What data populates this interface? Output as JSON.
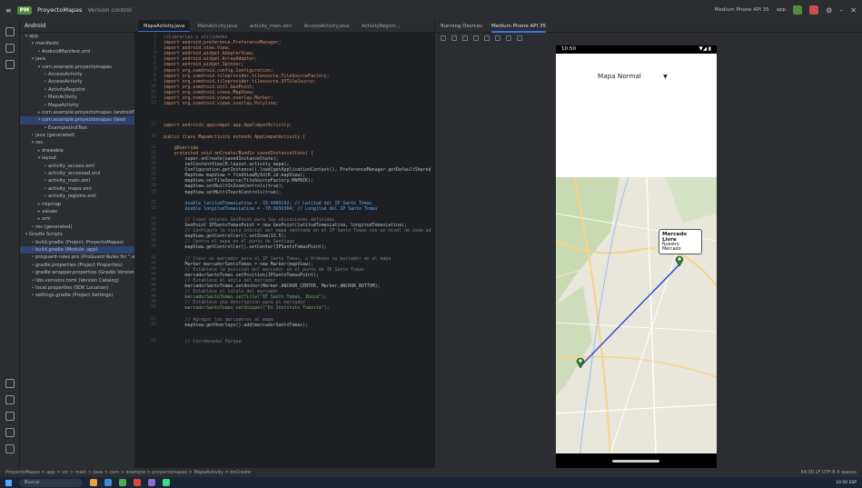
{
  "topbar": {
    "project_badge": "PM",
    "project_name": "ProyectoMapas",
    "version_control": "Version control",
    "device_selector": "Medium Phone API 35",
    "run_config": "app"
  },
  "project_panel": {
    "header": "Android",
    "rows": [
      {
        "label": "app",
        "indent": 0,
        "glyph": "▾"
      },
      {
        "label": "manifests",
        "indent": 1,
        "glyph": "▾"
      },
      {
        "label": "AndroidManifest.xml",
        "indent": 2,
        "glyph": ""
      },
      {
        "label": "java",
        "indent": 1,
        "glyph": "▾"
      },
      {
        "label": "com.example.proyectomapas",
        "indent": 2,
        "glyph": "▾"
      },
      {
        "label": "AccesoActivity",
        "indent": 3,
        "glyph": ""
      },
      {
        "label": "AccesoActivity",
        "indent": 3,
        "glyph": ""
      },
      {
        "label": "ActivityRegistro",
        "indent": 3,
        "glyph": ""
      },
      {
        "label": "MainActivity",
        "indent": 3,
        "glyph": ""
      },
      {
        "label": "MapaActivity",
        "indent": 3,
        "glyph": ""
      },
      {
        "label": "com.example.proyectomapas (androidTest)",
        "indent": 2,
        "glyph": "▸"
      },
      {
        "label": "com.example.proyectomapas (test)",
        "indent": 2,
        "glyph": "▾",
        "selected": true
      },
      {
        "label": "ExampleUnitTest",
        "indent": 3,
        "glyph": ""
      },
      {
        "label": "java (generated)",
        "indent": 1,
        "glyph": ""
      },
      {
        "label": "res",
        "indent": 1,
        "glyph": "▾"
      },
      {
        "label": "drawable",
        "indent": 2,
        "glyph": "▸"
      },
      {
        "label": "layout",
        "indent": 2,
        "glyph": "▾"
      },
      {
        "label": "activity_acceso.xml",
        "indent": 3,
        "glyph": ""
      },
      {
        "label": "activity_accesoad.xml",
        "indent": 3,
        "glyph": ""
      },
      {
        "label": "activity_main.xml",
        "indent": 3,
        "glyph": ""
      },
      {
        "label": "activity_mapa.xml",
        "indent": 3,
        "glyph": ""
      },
      {
        "label": "activity_registro.xml",
        "indent": 3,
        "glyph": ""
      },
      {
        "label": "mipmap",
        "indent": 2,
        "glyph": "▸"
      },
      {
        "label": "values",
        "indent": 2,
        "glyph": "▸"
      },
      {
        "label": "xml",
        "indent": 2,
        "glyph": "▸"
      },
      {
        "label": "res (generated)",
        "indent": 1,
        "glyph": ""
      },
      {
        "label": "Gradle Scripts",
        "indent": 0,
        "glyph": "▾"
      },
      {
        "label": "build.gradle (Project: ProyectoMapas)",
        "indent": 1,
        "glyph": ""
      },
      {
        "label": "build.gradle (Module :app)",
        "indent": 1,
        "glyph": "",
        "selected": true
      },
      {
        "label": "proguard-rules.pro (ProGuard Rules for \":app\")",
        "indent": 1,
        "glyph": ""
      },
      {
        "label": "gradle.properties (Project Properties)",
        "indent": 1,
        "glyph": ""
      },
      {
        "label": "gradle-wrapper.properties (Gradle Version)",
        "indent": 1,
        "glyph": ""
      },
      {
        "label": "libs.versions.toml (Version Catalog)",
        "indent": 1,
        "glyph": ""
      },
      {
        "label": "local.properties (SDK Location)",
        "indent": 1,
        "glyph": ""
      },
      {
        "label": "settings.gradle (Project Settings)",
        "indent": 1,
        "glyph": ""
      }
    ]
  },
  "editor": {
    "tabs": [
      {
        "label": "MapaActivity.java",
        "active": true
      },
      {
        "label": "MainActivity.java",
        "active": false
      },
      {
        "label": "activity_main.xml",
        "active": false
      },
      {
        "label": "AccesoActivity.java",
        "active": false
      },
      {
        "label": "ActivityRegistr...",
        "active": false
      }
    ],
    "lines": [
      {
        "n": 1,
        "t": "//Librerias y utilidades",
        "c": "cm"
      },
      {
        "n": 2,
        "t": "import android.preference.PreferenceManager;",
        "c": "kw"
      },
      {
        "n": 3,
        "t": "import android.view.View;",
        "c": "kw"
      },
      {
        "n": 4,
        "t": "import android.widget.AdapterView;",
        "c": "kw"
      },
      {
        "n": 5,
        "t": "import android.widget.ArrayAdapter;",
        "c": "kw"
      },
      {
        "n": 6,
        "t": "import android.widget.Spinner;",
        "c": "kw"
      },
      {
        "n": 7,
        "t": "import org.osmdroid.config.Configuration;",
        "c": "kw"
      },
      {
        "n": 8,
        "t": "import org.osmdroid.tileprovider.tilesource.TileSourceFactory;",
        "c": "kw"
      },
      {
        "n": 9,
        "t": "import org.osmdroid.tileprovider.tilesource.XYTileSource;",
        "c": "kw"
      },
      {
        "n": 10,
        "t": "import org.osmdroid.util.GeoPoint;",
        "c": "kw"
      },
      {
        "n": 11,
        "t": "import org.osmdroid.views.MapView;",
        "c": "kw"
      },
      {
        "n": 12,
        "t": "import org.osmdroid.views.overlay.Marker;",
        "c": "kw"
      },
      {
        "n": 13,
        "t": "import org.osmdroid.views.overlay.Polyline;",
        "c": "kw"
      },
      {
        "n": 17,
        "t": "import androidx.appcompat.app.AppCompatActivity;",
        "c": "kw"
      },
      {
        "n": 19,
        "t": "public class MapaActivity extends AppCompatActivity {",
        "c": "kw"
      },
      {
        "n": 21,
        "t": "    @Override",
        "c": "an"
      },
      {
        "n": 22,
        "t": "    protected void onCreate(Bundle savedInstanceState) {",
        "c": "kw"
      },
      {
        "n": 23,
        "t": "        super.onCreate(savedInstanceState);",
        "c": ""
      },
      {
        "n": 24,
        "t": "        setContentView(R.layout.activity_mapa);",
        "c": ""
      },
      {
        "n": 25,
        "t": "        Configuration.getInstance().load(getApplicationContext(), PreferenceManager.getDefaultShared",
        "c": ""
      },
      {
        "n": 26,
        "t": "        MapView mapView = findViewById(R.id.mapView);",
        "c": ""
      },
      {
        "n": 27,
        "t": "        mapView.setTileSource(TileSourceFactory.MAPNIK);",
        "c": ""
      },
      {
        "n": 28,
        "t": "        mapView.setBuiltInZoomControls(true);",
        "c": ""
      },
      {
        "n": 29,
        "t": "        mapView.setMultiTouchControls(true);",
        "c": ""
      },
      {
        "n": 31,
        "t": "        double latitudTomasLatina = -33.4489142; // Latitud del IP Santo Tomas",
        "c": "hl"
      },
      {
        "n": 32,
        "t": "        double longitudTomasLatina = -70.6656364; // Longitud del IP Santo Tomas",
        "c": "hl"
      },
      {
        "n": 34,
        "t": "        // Crear objetos GeoPoint para las ubicaciones definidas",
        "c": "cm"
      },
      {
        "n": 35,
        "t": "        GeoPoint IPSantoTomasPoint = new GeoPoint(latitudTomasLatina, longitudTomasLatina);",
        "c": ""
      },
      {
        "n": 36,
        "t": "        // Configura la vista inicial del mapa centrada en el IP Santo Tomas con un nivel de zoom ad",
        "c": "cm"
      },
      {
        "n": 37,
        "t": "        mapView.getController().setZoom(13.5);",
        "c": ""
      },
      {
        "n": 38,
        "t": "        // Centra el mapa en el punto de Santiago",
        "c": "cm"
      },
      {
        "n": 39,
        "t": "        mapView.getController().setCenter(IPSantoTomasPoint);",
        "c": ""
      },
      {
        "n": 41,
        "t": "        // Crear un marcador para el IP Santo Tomas, a Ordenes su marcador en el mapa",
        "c": "cm"
      },
      {
        "n": 42,
        "t": "        Marker marcadorSantoTomas = new Marker(mapView);",
        "c": ""
      },
      {
        "n": 43,
        "t": "        // Establece la posicion del marcador en el punto de IP Santo Tomas",
        "c": "cm"
      },
      {
        "n": 44,
        "t": "        marcadorSantoTomas.setPosition(IPSantoTomasPoint);",
        "c": ""
      },
      {
        "n": 45,
        "t": "        // Establece el ancla del marcador",
        "c": "cm"
      },
      {
        "n": 46,
        "t": "        marcadorSantoTomas.setAnchor(Marker.ANCHOR_CENTER, Marker.ANCHOR_BOTTOM);",
        "c": ""
      },
      {
        "n": 47,
        "t": "        // Establece el titulo del marcador",
        "c": "cm"
      },
      {
        "n": 48,
        "t": "        marcadorSantoTomas.setTitle(\"IP Santo Tomas, Ibiza\");",
        "c": "str"
      },
      {
        "n": 49,
        "t": "        // Establece una descripcion para el marcador",
        "c": "cm"
      },
      {
        "n": 50,
        "t": "        marcadorSantoTomas.setSnippet(\"En Instituto Tomista\");",
        "c": "str"
      },
      {
        "n": 52,
        "t": "        // Agregar los marcadores al mapa",
        "c": "cm"
      },
      {
        "n": 53,
        "t": "        mapView.getOverlays().add(marcadorSantoTomas);",
        "c": ""
      },
      {
        "n": 56,
        "t": "        // Coordenadas Parque",
        "c": "cm"
      }
    ]
  },
  "device_panel": {
    "tab_running": "Running Devices",
    "tab_device": "Medium Phone API 35",
    "phone": {
      "time": "10:50",
      "signal": "▼◢ ▮",
      "spinner_value": "Mapa Normal",
      "marker_title": "Mercado Livre",
      "marker_snippet": "Nuestro Mercado"
    }
  },
  "statusbar": {
    "path": "ProyectoMapas > app > src > main > java > com > example > proyectomapas > MapaActivity > onCreate",
    "right": "54:30  LF  UTF-8  4 spaces"
  },
  "taskbar": {
    "search": "Buscar",
    "tray": "10:50  ESP"
  },
  "colors": {
    "accent": "#3574f0",
    "keyword": "#cf8e6d",
    "comment": "#7a7e85",
    "string": "#6aab73",
    "route": "#1f3fd1",
    "marker": "#2e7d32"
  }
}
